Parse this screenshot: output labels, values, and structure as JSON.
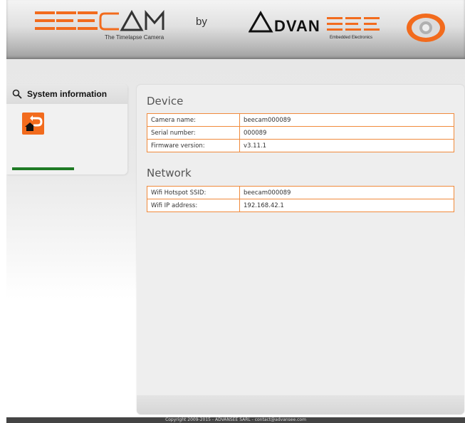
{
  "header": {
    "brand": "BEECAM",
    "tagline": "The Timelapse Camera",
    "by": "by",
    "partner": "ADVANSEE",
    "partner_tagline": "Embedded Electronics"
  },
  "sidebar": {
    "title": "System information",
    "progress": 0.5
  },
  "device": {
    "title": "Device",
    "rows": [
      {
        "label": "Camera name:",
        "value": "beecam000089"
      },
      {
        "label": "Serial number:",
        "value": "000089"
      },
      {
        "label": "Firmware version:",
        "value": "v3.11.1"
      }
    ]
  },
  "network": {
    "title": "Network",
    "rows": [
      {
        "label": "Wifi Hotspot SSID:",
        "value": "beecam000089"
      },
      {
        "label": "Wifi IP address:",
        "value": "192.168.42.1"
      }
    ]
  },
  "footer": {
    "copyright": "Copyright 2009-2015 - ADVANSEE SARL - contact@advansee.com"
  },
  "colors": {
    "accent": "#f26b1d",
    "table_border": "#f08a3c",
    "progress": "#1e7a24"
  }
}
